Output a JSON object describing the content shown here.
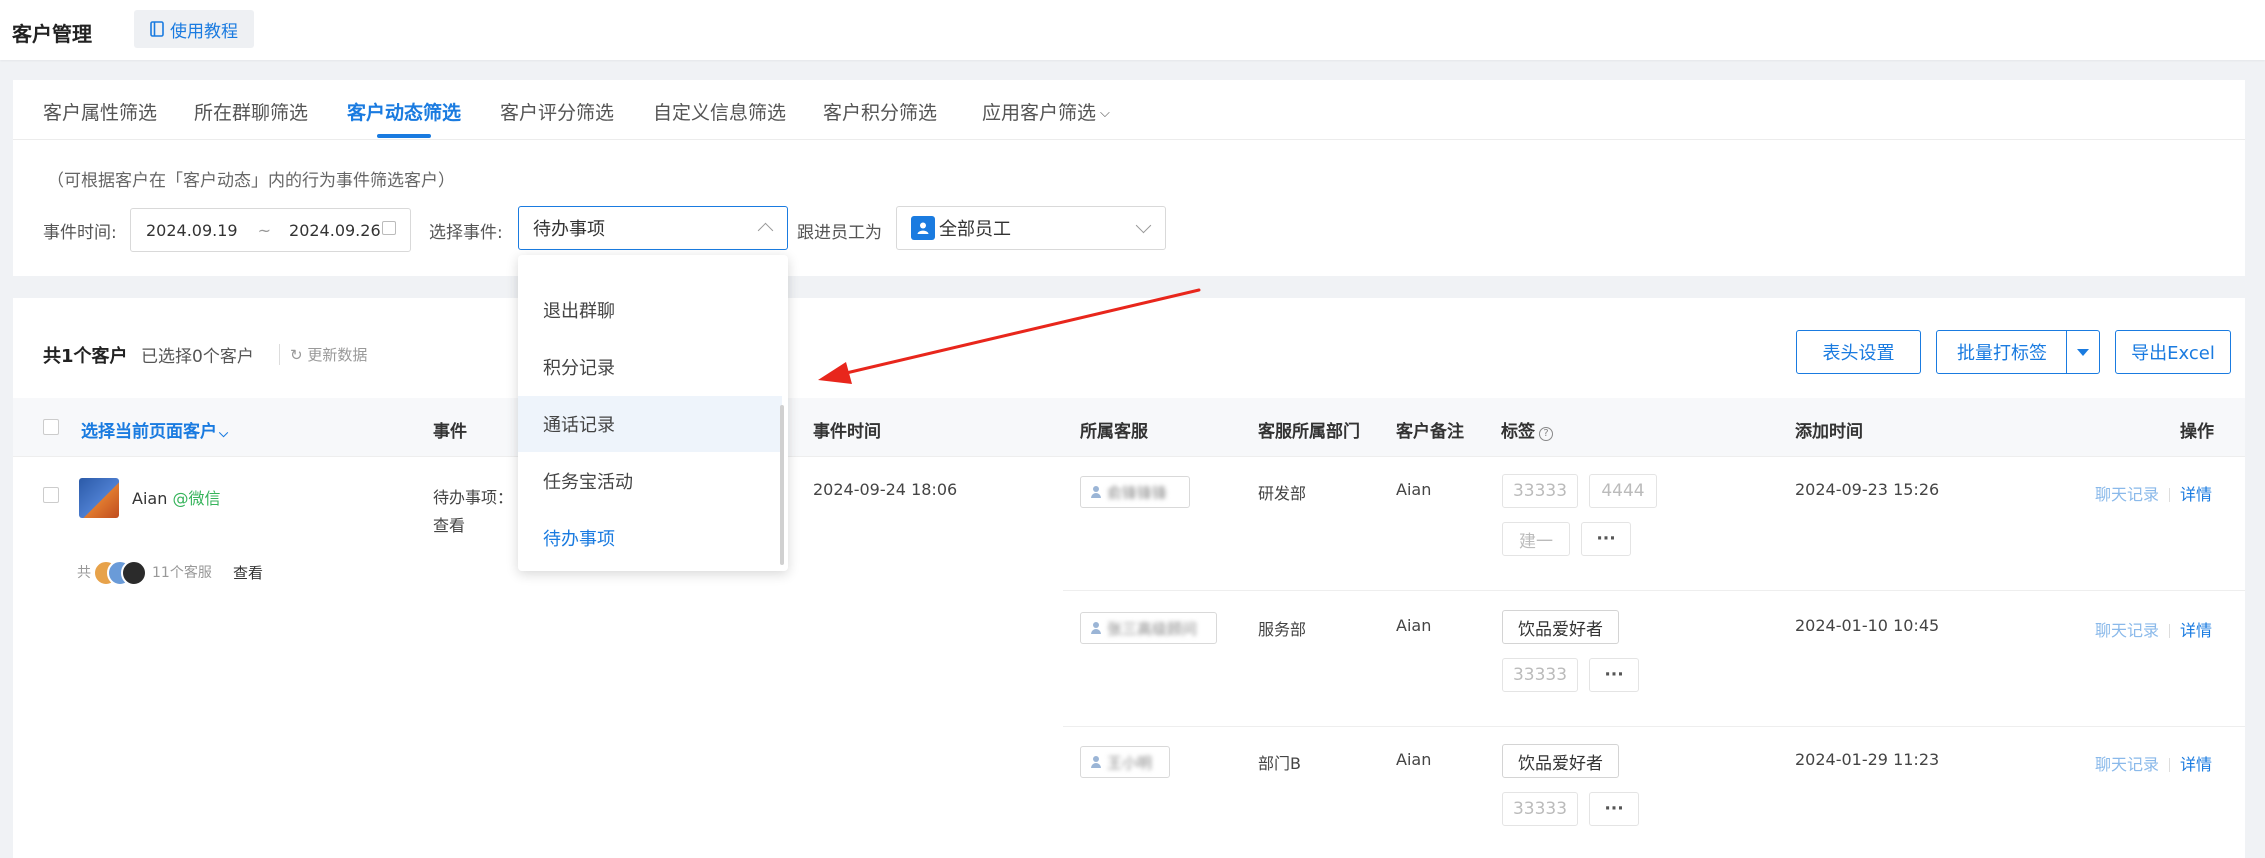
{
  "header": {
    "title": "客户管理",
    "tutorial_label": "使用教程"
  },
  "tabs": [
    {
      "label": "客户属性筛选"
    },
    {
      "label": "所在群聊筛选"
    },
    {
      "label": "客户动态筛选"
    },
    {
      "label": "客户评分筛选"
    },
    {
      "label": "自定义信息筛选"
    },
    {
      "label": "客户积分筛选"
    },
    {
      "label": "应用客户筛选"
    }
  ],
  "active_tab": "客户动态筛选",
  "filter": {
    "hint": "（可根据客户在「客户动态」内的行为事件筛选客户）",
    "time_label": "事件时间:",
    "date_start": "2024.09.19",
    "date_sep": "~",
    "date_end": "2024.09.26",
    "event_label": "选择事件:",
    "event_value": "待办事项",
    "follow_label": "跟进员工为",
    "follow_value": "全部员工"
  },
  "event_dropdown": {
    "options": [
      "退出群聊",
      "积分记录",
      "通话记录",
      "任务宝活动",
      "待办事项"
    ],
    "hovered": "通话记录",
    "selected": "待办事项"
  },
  "summary": {
    "total": "共1个客户",
    "selected": "已选择0个客户",
    "refresh": "更新数据"
  },
  "toolbar": {
    "header_settings": "表头设置",
    "batch_tag": "批量打标签",
    "export": "导出Excel"
  },
  "columns": {
    "select_page": "选择当前页面客户",
    "event": "事件",
    "event_time": "事件时间",
    "agent": "所属客服",
    "dept": "客服所属部门",
    "remark": "客户备注",
    "tags": "标签",
    "added": "添加时间",
    "ops": "操作"
  },
  "customer": {
    "name": "Aian",
    "source": "@微信",
    "event_line1": "待办事项：",
    "event_line2": "查看",
    "event_time": "2024-09-24 18:06",
    "agents_prefix": "共",
    "agents_count": "11个客服",
    "agents_view": "查看"
  },
  "rows": [
    {
      "agent": "俞锋锋锋",
      "dept": "研发部",
      "remark": "Aian",
      "tags": [
        "33333",
        "4444",
        "建一"
      ],
      "more": "···",
      "added": "2024-09-23 15:26",
      "chat": "聊天记录",
      "detail": "详情"
    },
    {
      "agent": "张三高级顾问",
      "dept": "服务部",
      "remark": "Aian",
      "tags": [
        "饮品爱好者",
        "33333"
      ],
      "more": "···",
      "added": "2024-01-10 10:45",
      "chat": "聊天记录",
      "detail": "详情"
    },
    {
      "agent": "王小明",
      "dept": "部门B",
      "remark": "Aian",
      "tags": [
        "饮品爱好者",
        "33333"
      ],
      "more": "···",
      "added": "2024-01-29 11:23",
      "chat": "聊天记录",
      "detail": "详情"
    }
  ],
  "colors": {
    "accent": "#1a7be0",
    "annotation_arrow": "#e8261c"
  }
}
